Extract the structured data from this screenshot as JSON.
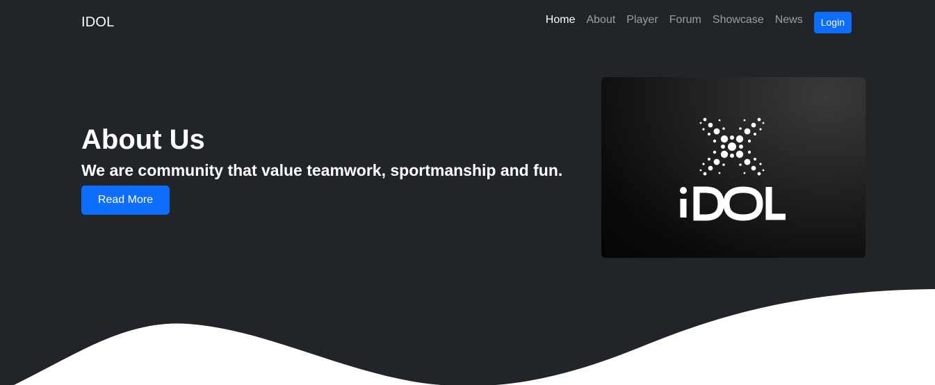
{
  "navbar": {
    "brand": "IDOL",
    "links": [
      {
        "label": "Home",
        "active": true
      },
      {
        "label": "About",
        "active": false
      },
      {
        "label": "Player",
        "active": false
      },
      {
        "label": "Forum",
        "active": false
      },
      {
        "label": "Showcase",
        "active": false
      },
      {
        "label": "News",
        "active": false
      }
    ],
    "login_label": "Login"
  },
  "hero": {
    "title": "About Us",
    "subtitle": "We are community that value teamwork, sportmanship and fun.",
    "button_label": "Read More",
    "image": {
      "logo_text": "IDOL",
      "logo_icon": "dotted-x-icon"
    }
  },
  "colors": {
    "background": "#212529",
    "primary": "#0d6efd",
    "wave": "#ffffff",
    "nav_inactive": "rgba(255,255,255,0.55)"
  }
}
